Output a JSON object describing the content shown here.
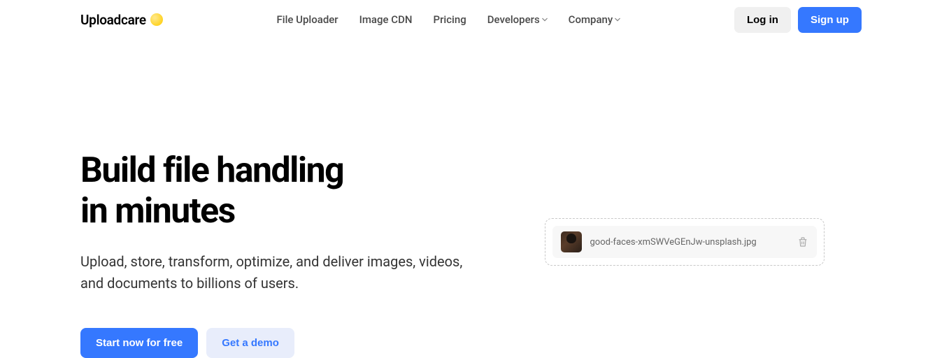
{
  "logo": {
    "text": "Uploadcare"
  },
  "nav": {
    "items": [
      {
        "label": "File Uploader",
        "hasDropdown": false
      },
      {
        "label": "Image CDN",
        "hasDropdown": false
      },
      {
        "label": "Pricing",
        "hasDropdown": false
      },
      {
        "label": "Developers",
        "hasDropdown": true
      },
      {
        "label": "Company",
        "hasDropdown": true
      }
    ]
  },
  "auth": {
    "login": "Log in",
    "signup": "Sign up"
  },
  "hero": {
    "title_line1": "Build file handling",
    "title_line2": "in minutes",
    "subtitle": "Upload, store, transform, optimize, and deliver images, videos, and documents to billions of users.",
    "cta_primary": "Start now for free",
    "cta_secondary": "Get a demo"
  },
  "upload": {
    "filename": "good-faces-xmSWVeGEnJw-unsplash.jpg"
  }
}
